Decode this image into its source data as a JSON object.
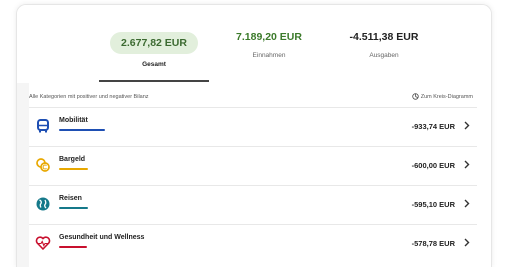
{
  "summary": {
    "total": {
      "amount": "2.677,82 EUR",
      "label": "Gesamt"
    },
    "income": {
      "amount": "7.189,20 EUR",
      "label": "Einnahmen"
    },
    "expenses": {
      "amount": "-4.511,38 EUR",
      "label": "Ausgaben"
    },
    "active_tab": "total"
  },
  "list": {
    "title": "Alle Kategorien mit positiver und negativer Bilanz",
    "pie_link": "Zum Kreis-Diagramm",
    "pie_icon": "pie-chart-icon",
    "categories": [
      {
        "name": "Mobilität",
        "amount": "-933,74 EUR",
        "icon": "bus-icon",
        "color": "#1e4fb3",
        "share": 0.207
      },
      {
        "name": "Bargeld",
        "amount": "-600,00 EUR",
        "icon": "coins-icon",
        "color": "#e8a800",
        "share": 0.133
      },
      {
        "name": "Reisen",
        "amount": "-595,10 EUR",
        "icon": "globe-icon",
        "color": "#15798a",
        "share": 0.132
      },
      {
        "name": "Gesundheit und Wellness",
        "amount": "-578,78 EUR",
        "icon": "heart-pulse-icon",
        "color": "#c8102e",
        "share": 0.128
      }
    ]
  }
}
